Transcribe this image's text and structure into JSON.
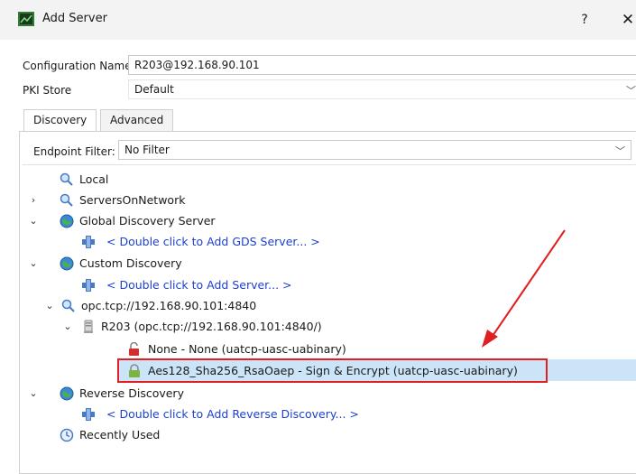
{
  "window": {
    "title": "Add Server",
    "help_label": "?",
    "close_label": "✕"
  },
  "form": {
    "config_name_label": "Configuration Name",
    "config_name_value": "R203@192.168.90.101",
    "pki_label": "PKI Store",
    "pki_value": "Default"
  },
  "tabs": [
    {
      "label": "Discovery",
      "active": true
    },
    {
      "label": "Advanced",
      "active": false
    }
  ],
  "endpoint_filter": {
    "label": "Endpoint Filter:",
    "value": "No Filter"
  },
  "tree": {
    "local": "Local",
    "servers_on_network": "ServersOnNetwork",
    "global_discovery": "Global Discovery Server",
    "add_gds": "< Double click to Add GDS Server... >",
    "custom_discovery": "Custom Discovery",
    "add_server": "< Double click to Add Server... >",
    "endpoint_url": "opc.tcp://192.168.90.101:4840",
    "server_node": "R203 (opc.tcp://192.168.90.101:4840/)",
    "policy_none": "None - None (uatcp-uasc-uabinary)",
    "policy_aes": "Aes128_Sha256_RsaOaep - Sign & Encrypt (uatcp-uasc-uabinary)",
    "reverse_discovery": "Reverse Discovery",
    "add_reverse": "< Double click to Add Reverse Discovery... >",
    "recently_used": "Recently Used"
  },
  "colors": {
    "link": "#1c3fd1",
    "selection": "#cce4f7",
    "annotation": "#e02020"
  }
}
